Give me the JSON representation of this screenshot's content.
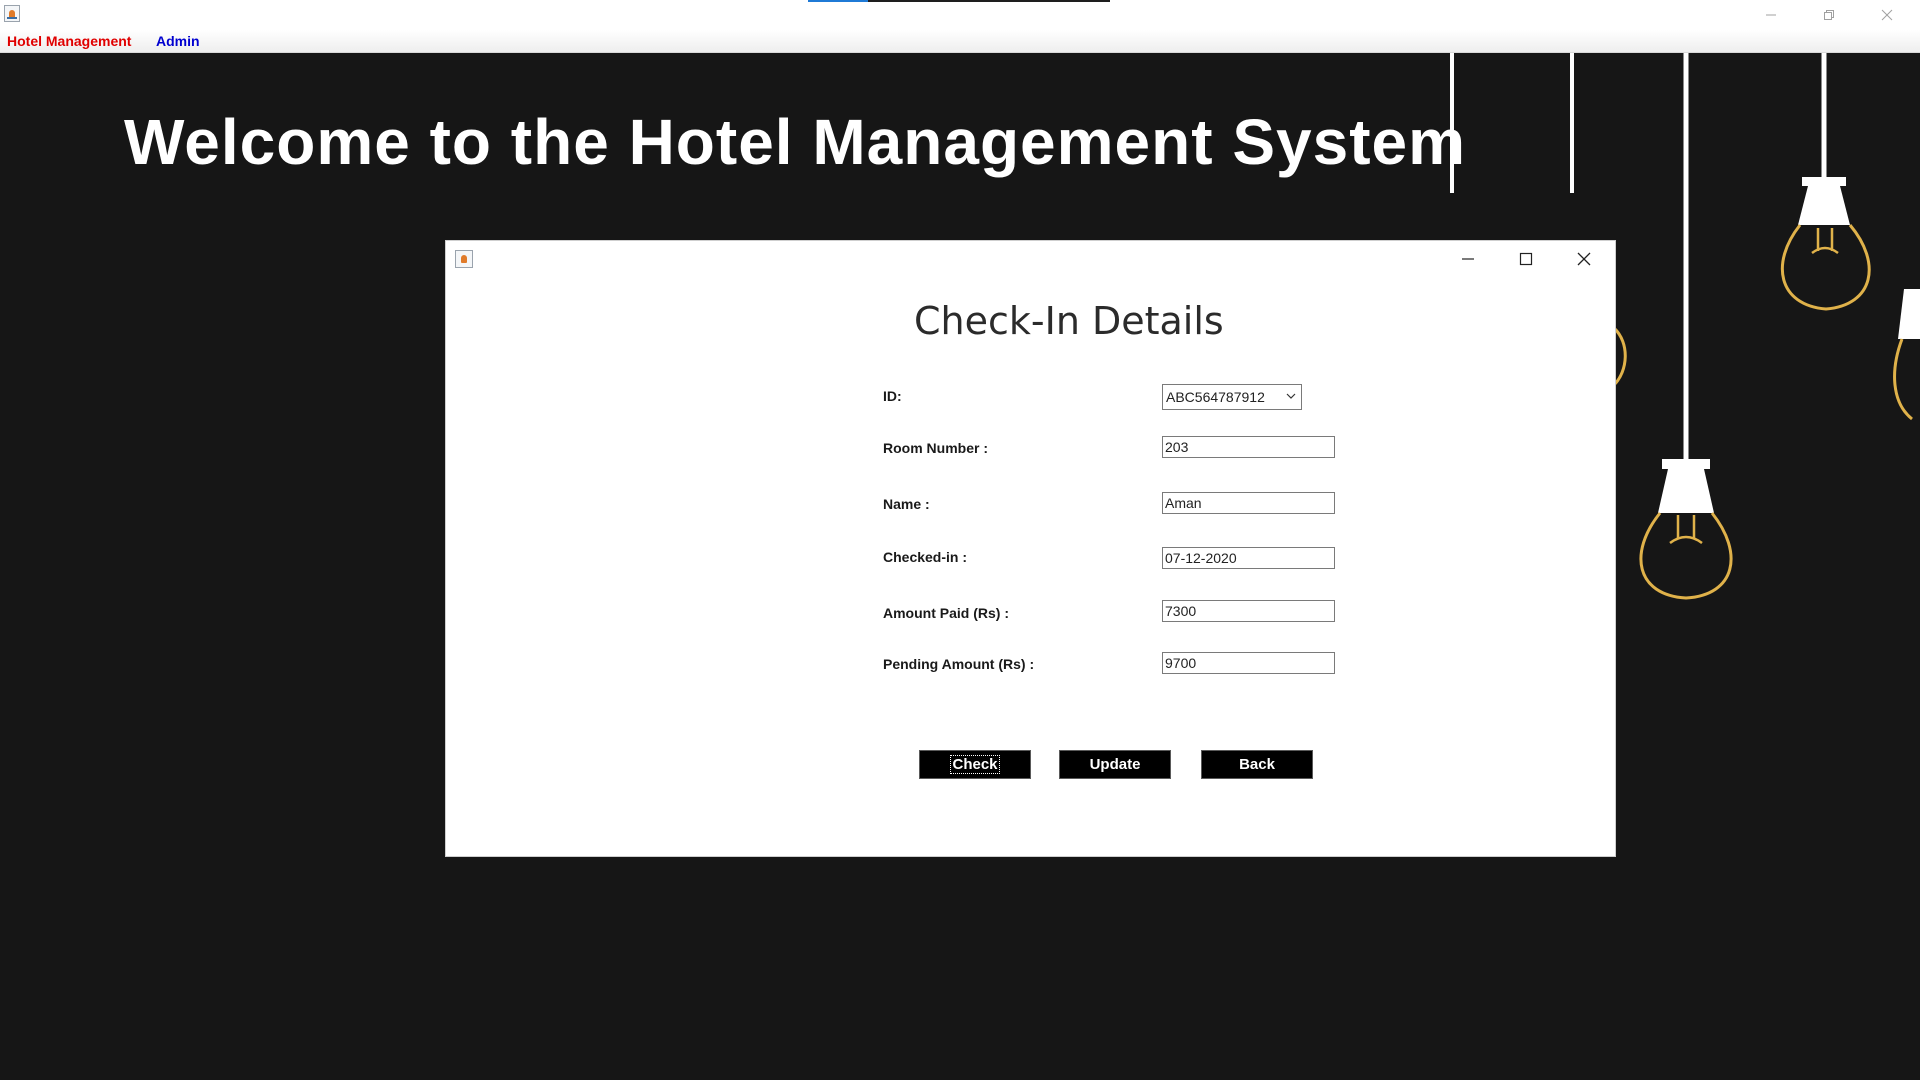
{
  "window": {
    "controls": {
      "minimize": "—",
      "maximize": "❐",
      "close": "✕"
    },
    "loading_progress": 0.2
  },
  "menubar": {
    "items": [
      {
        "label": "Hotel Management",
        "color": "#e00000"
      },
      {
        "label": "Admin",
        "color": "#0000d0"
      }
    ]
  },
  "main": {
    "welcome_title": "Welcome to the Hotel Management System",
    "background_color": "#161616",
    "bulb_color": "#e0b24a"
  },
  "dialog": {
    "title": "Check-In Details",
    "controls": {
      "minimize": "—",
      "maximize": "☐",
      "close": "✕"
    },
    "fields": {
      "id": {
        "label": "ID:",
        "value": "ABC564787912"
      },
      "room_number": {
        "label": "Room Number :",
        "value": "203"
      },
      "name": {
        "label": "Name :",
        "value": "Aman"
      },
      "checked_in": {
        "label": "Checked-in :",
        "value": "07-12-2020"
      },
      "amount_paid": {
        "label": "Amount Paid (Rs) :",
        "value": "7300"
      },
      "pending_amount": {
        "label": "Pending Amount (Rs) :",
        "value": "9700"
      }
    },
    "buttons": {
      "check": "Check",
      "update": "Update",
      "back": "Back"
    }
  }
}
